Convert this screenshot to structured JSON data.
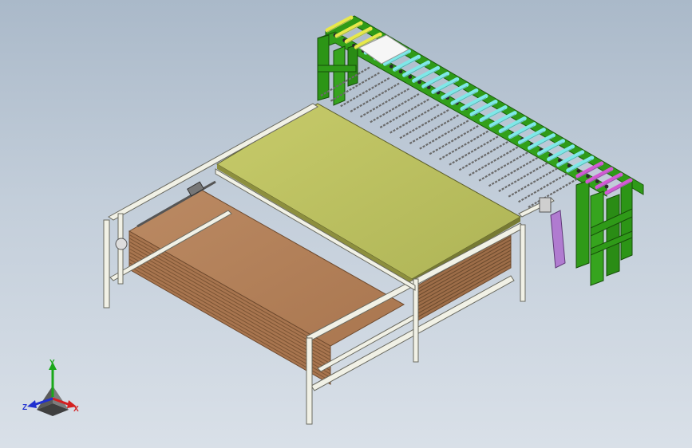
{
  "viewport": {
    "background_top": "#aab9c9",
    "background_bottom": "#d9e0e8"
  },
  "model": {
    "colors": {
      "frame_green": "#2f9a18",
      "frame_green_dark": "#1e6e0e",
      "roller_yellow": "#e8e84a",
      "roller_cyan": "#7fe8e8",
      "roller_magenta": "#d35ad3",
      "table_top": "#b8bd5e",
      "board_stack": "#b5825c",
      "board_edge": "#8a5e3e",
      "rail_white": "#f1f1e6",
      "bracket_violet": "#b07bd0"
    }
  },
  "triad": {
    "x_label": "X",
    "y_label": "Y",
    "z_label": "Z",
    "x_color": "#d42020",
    "y_color": "#1aa81a",
    "z_color": "#2030d0"
  }
}
